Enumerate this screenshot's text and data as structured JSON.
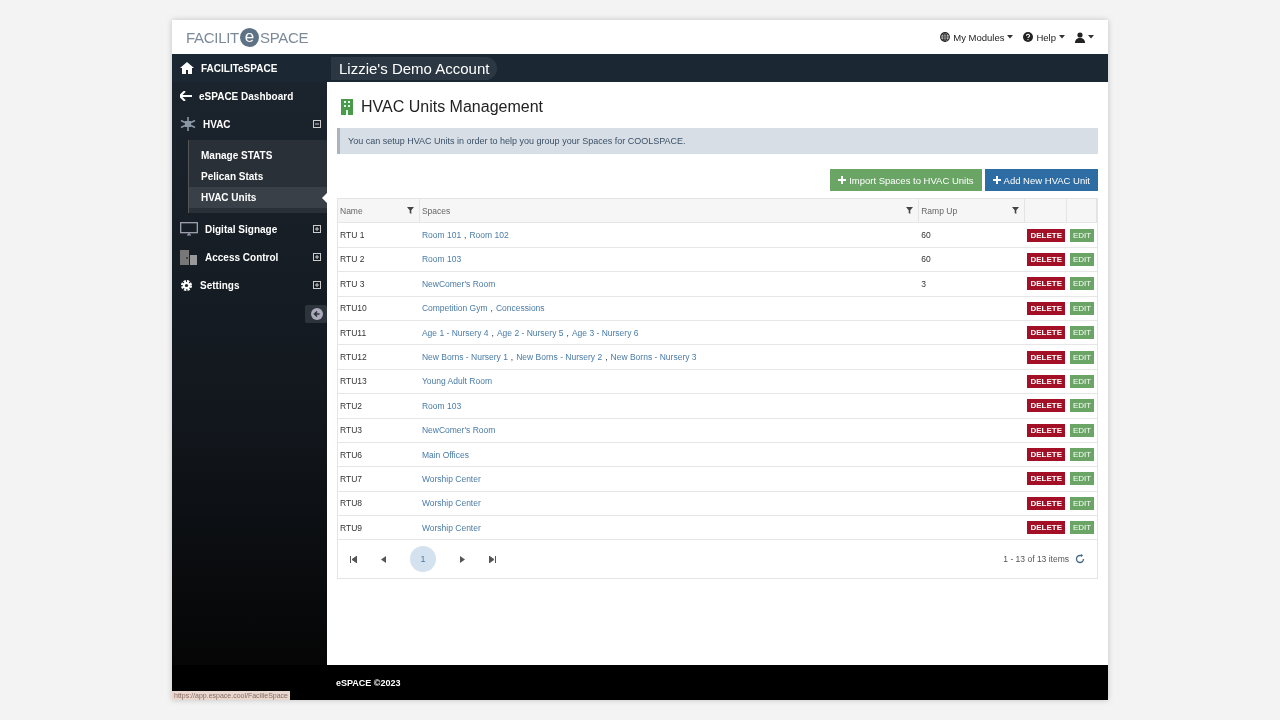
{
  "logo": {
    "left": "FACILIT",
    "mark": "e",
    "right": "SPACE"
  },
  "top_nav": [
    {
      "label": "My Modules",
      "kind": "globe"
    },
    {
      "label": "Help",
      "kind": "help"
    },
    {
      "kind": "user"
    }
  ],
  "account_title": "Lizzie's Demo Account",
  "sidebar": {
    "home": "FACILITeSPACE",
    "items": [
      {
        "label": "eSPACE Dashboard",
        "kind": "back"
      },
      {
        "label": "HVAC",
        "kind": "hvac",
        "expanded": true,
        "children": [
          {
            "label": "Manage STATS",
            "selected": false
          },
          {
            "label": "Pelican Stats",
            "selected": false
          },
          {
            "label": "HVAC Units",
            "selected": true
          }
        ]
      },
      {
        "label": "Digital Signage",
        "kind": "monitor",
        "expanded": false
      },
      {
        "label": "Access Control",
        "kind": "door",
        "expanded": false
      },
      {
        "label": "Settings",
        "kind": "gear",
        "expanded": false
      }
    ]
  },
  "page_title": "HVAC Units Management",
  "info": "You can setup HVAC Units in order to help you group your Spaces for COOLSPACE.",
  "actions": [
    {
      "label": "Import Spaces to HVAC Units",
      "kind": "success"
    },
    {
      "label": "Add New HVAC Unit",
      "kind": "primary"
    }
  ],
  "table": {
    "columns": [
      "Name",
      "Spaces",
      "Ramp Up"
    ],
    "rows": [
      {
        "name": "RTU 1",
        "spaces": [
          {
            "label": "Room 101"
          },
          {
            "sep": ",",
            "label": "Room 102"
          }
        ],
        "ramp_up": "60",
        "buttons": [
          "DELETE",
          "EDIT"
        ]
      },
      {
        "name": "RTU 2",
        "spaces": [
          {
            "label": "Room 103"
          }
        ],
        "ramp_up": "60",
        "buttons": [
          "DELETE",
          "EDIT"
        ]
      },
      {
        "name": "RTU 3",
        "spaces": [
          {
            "label": "NewComer's Room"
          }
        ],
        "ramp_up": "3",
        "buttons": [
          "DELETE",
          "EDIT"
        ]
      },
      {
        "name": "RTU10",
        "spaces": [
          {
            "label": "Competition Gym"
          },
          {
            "sep": ",",
            "label": "Concessions"
          }
        ],
        "buttons": [
          "DELETE",
          "EDIT"
        ]
      },
      {
        "name": "RTU11",
        "spaces": [
          {
            "label": "Age 1 - Nursery 4"
          },
          {
            "sep": ",",
            "label": "Age 2 - Nursery 5"
          },
          {
            "sep": ",",
            "label": "Age 3 - Nursery 6"
          }
        ],
        "buttons": [
          "DELETE",
          "EDIT"
        ]
      },
      {
        "name": "RTU12",
        "spaces": [
          {
            "label": "New Borns - Nursery 1"
          },
          {
            "sep": ",",
            "label": "New Borns - Nursery 2"
          },
          {
            "sep": ",",
            "label": "New Borns - Nursery 3"
          }
        ],
        "buttons": [
          "DELETE",
          "EDIT"
        ]
      },
      {
        "name": "RTU13",
        "spaces": [
          {
            "label": "Young Adult Room"
          }
        ],
        "buttons": [
          "DELETE",
          "EDIT"
        ]
      },
      {
        "name": "RTU2",
        "spaces": [
          {
            "label": "Room 103"
          }
        ],
        "buttons": [
          "DELETE",
          "EDIT"
        ]
      },
      {
        "name": "RTU3",
        "spaces": [
          {
            "label": "NewComer's Room"
          }
        ],
        "buttons": [
          "DELETE",
          "EDIT"
        ]
      },
      {
        "name": "RTU6",
        "spaces": [
          {
            "label": "Main Offices"
          }
        ],
        "buttons": [
          "DELETE",
          "EDIT"
        ]
      },
      {
        "name": "RTU7",
        "spaces": [
          {
            "label": "Worship Center"
          }
        ],
        "buttons": [
          "DELETE",
          "EDIT"
        ]
      },
      {
        "name": "RTU8",
        "spaces": [
          {
            "label": "Worship Center"
          }
        ],
        "buttons": [
          "DELETE",
          "EDIT"
        ]
      },
      {
        "name": "RTU9",
        "spaces": [
          {
            "label": "Worship Center"
          }
        ],
        "buttons": [
          "DELETE",
          "EDIT"
        ]
      }
    ]
  },
  "pager": {
    "pages": [
      {
        "label": "1",
        "selected": true
      }
    ],
    "info": "1 - 13 of 13 items"
  },
  "footer": "eSPACE ©2023",
  "status_url": "https://app.espace.cool/FacilieSpace"
}
